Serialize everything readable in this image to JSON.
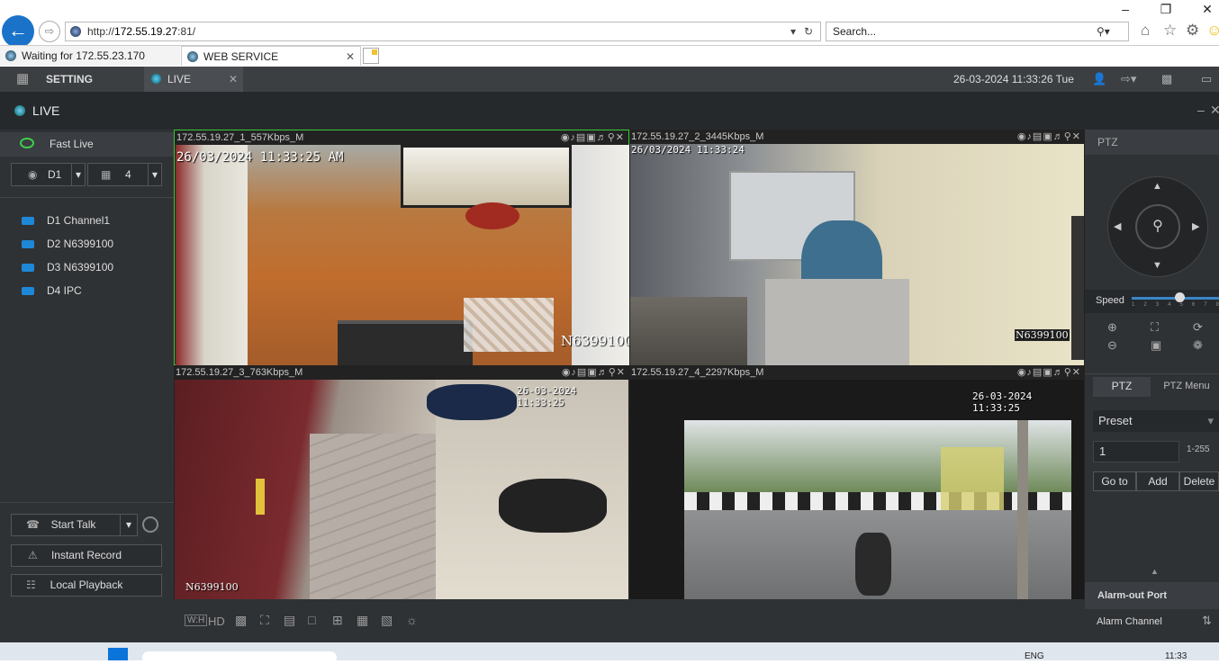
{
  "browser": {
    "url": "http://172.55.19.27:81/",
    "url_prefix": "http://",
    "url_host": "172.55.19.27",
    "url_port": ":81/",
    "search_placeholder": "Search...",
    "tabs": [
      {
        "label": "Waiting for 172.55.23.170"
      },
      {
        "label": "WEB SERVICE"
      }
    ]
  },
  "app": {
    "setting_label": "SETTING",
    "live_tab_label": "LIVE",
    "datetime": "26-03-2024 11:33:26 Tue",
    "live_title": "LIVE",
    "left": {
      "fast_live": "Fast Live",
      "device_select": "D1",
      "split_select": "4",
      "channels": [
        {
          "label": "D1 Channel1"
        },
        {
          "label": "D2 N6399100"
        },
        {
          "label": "D3 N6399100"
        },
        {
          "label": "D4 IPC"
        }
      ],
      "start_talk": "Start Talk",
      "instant_record": "Instant Record",
      "local_playback": "Local Playback"
    },
    "panes": [
      {
        "caption": "172.55.19.27_1_557Kbps_M",
        "timestamp": "26/03/2024 11:33:25 AM",
        "watermark": "N6399100"
      },
      {
        "caption": "172.55.19.27_2_3445Kbps_M",
        "timestamp": "26/03/2024 11:33:24",
        "watermark": "N6399100"
      },
      {
        "caption": "172.55.19.27_3_763Kbps_M",
        "timestamp": "26-03-2024 11:33:25",
        "watermark": "N6399100"
      },
      {
        "caption": "172.55.19.27_4_2297Kbps_M",
        "timestamp": "26-03-2024  11:33:25",
        "watermark": ""
      }
    ],
    "bottom_hd": "HD",
    "right": {
      "ptz_title": "PTZ",
      "speed_label": "Speed",
      "speed_ticks": [
        "1",
        "2",
        "3",
        "4",
        "5",
        "6",
        "7",
        "8"
      ],
      "speed_value": 5,
      "ptz_tab": "PTZ",
      "ptz_menu_tab": "PTZ Menu",
      "preset_label": "Preset",
      "preset_value": "1",
      "preset_range": "1-255",
      "goto": "Go to",
      "add": "Add",
      "delete": "Delete",
      "alarm_out": "Alarm-out Port",
      "alarm_channel": "Alarm Channel"
    }
  },
  "taskbar": {
    "lang": "ENG",
    "time": "11:33"
  }
}
